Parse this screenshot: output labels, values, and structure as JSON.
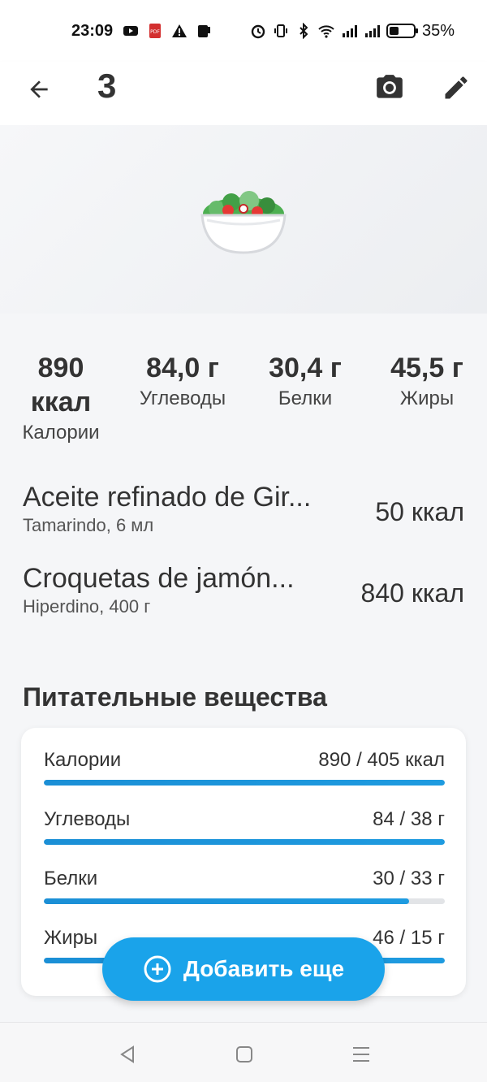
{
  "status_bar": {
    "time": "23:09",
    "battery_percent": "35%"
  },
  "app_bar": {
    "title": "3"
  },
  "macros": {
    "calories_value": "890 ккал",
    "calories_label": "Калории",
    "carbs_value": "84,0 г",
    "carbs_label": "Углеводы",
    "protein_value": "30,4 г",
    "protein_label": "Белки",
    "fat_value": "45,5 г",
    "fat_label": "Жиры"
  },
  "foods": [
    {
      "name": "Aceite refinado de Gir...",
      "meta": "Tamarindo, 6 мл",
      "kcal": "50 ккал"
    },
    {
      "name": "Croquetas de jamón...",
      "meta": "Hiperdino, 400 г",
      "kcal": "840 ккал"
    }
  ],
  "nutrients": {
    "title": "Питательные вещества",
    "rows": [
      {
        "label": "Калории",
        "value": "890 / 405 ккал",
        "progress": 1.0
      },
      {
        "label": "Углеводы",
        "value": "84 / 38 г",
        "progress": 1.0
      },
      {
        "label": "Белки",
        "value": "30 / 33 г",
        "progress": 0.91
      },
      {
        "label": "Жиры",
        "value": "46 / 15 г",
        "progress": 1.0
      }
    ]
  },
  "fab": {
    "label": "Добавить еще"
  },
  "colors": {
    "accent": "#1aa3ea",
    "progress": "#1b8fd6"
  }
}
